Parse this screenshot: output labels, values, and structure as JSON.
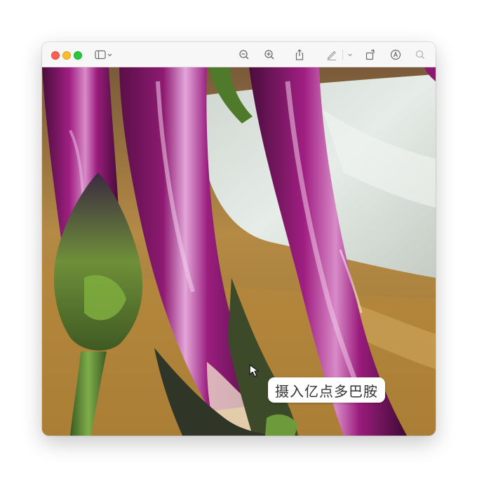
{
  "window": {
    "buttons": [
      "close",
      "minimize",
      "zoom"
    ]
  },
  "toolbar": {
    "icons": [
      "sidebar-toggle-icon",
      "zoom-out-icon",
      "zoom-in-icon",
      "share-icon",
      "markup-icon",
      "rotate-icon",
      "annotate-icon",
      "search-icon"
    ]
  },
  "content": {
    "photo_subject": "eggplants"
  },
  "caption": {
    "text": "摄入亿点多巴胺"
  },
  "colors": {
    "eggplant": "#8a1a6e",
    "stem": "#5b8f3a",
    "background": "#b8893f"
  }
}
